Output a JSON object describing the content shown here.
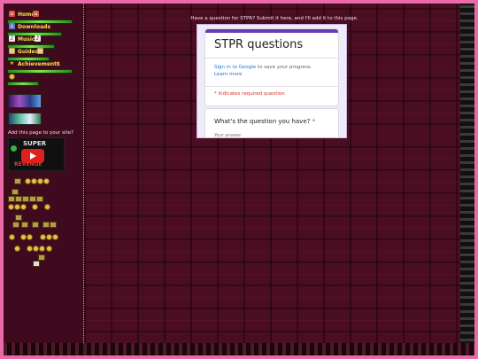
{
  "sidebar": {
    "nav": [
      {
        "label": "Home",
        "icon": "home-icon"
      },
      {
        "label": "Downloads",
        "icon": "download-icon"
      },
      {
        "label": "Music",
        "icon": "music-icon"
      },
      {
        "label": "Guides",
        "icon": "guide-icon"
      },
      {
        "label": "Achievements",
        "icon": "star-icon"
      },
      {
        "label": "",
        "icon": "coin-icon"
      }
    ],
    "share_text": "Add this page to your site?",
    "video_badge_text": "SUPER",
    "video_badge_subtext": "REVENGE"
  },
  "main": {
    "notice": "Have a question for STPR? Submit it here, and I'll add it to this page."
  },
  "form": {
    "title": "STPR questions",
    "signin_link": "Sign in to Google",
    "signin_rest": " to save your progress.",
    "learn_more": "Learn more",
    "required_note": "* Indicates required question",
    "question_label": "What's the question you have?",
    "question_required_mark": " *",
    "answer_placeholder": "Your answer"
  },
  "colors": {
    "accent_form": "#673ab7",
    "nav_text": "#f5e24a",
    "page_border": "#e96aa6",
    "background": "#4b0d22"
  }
}
